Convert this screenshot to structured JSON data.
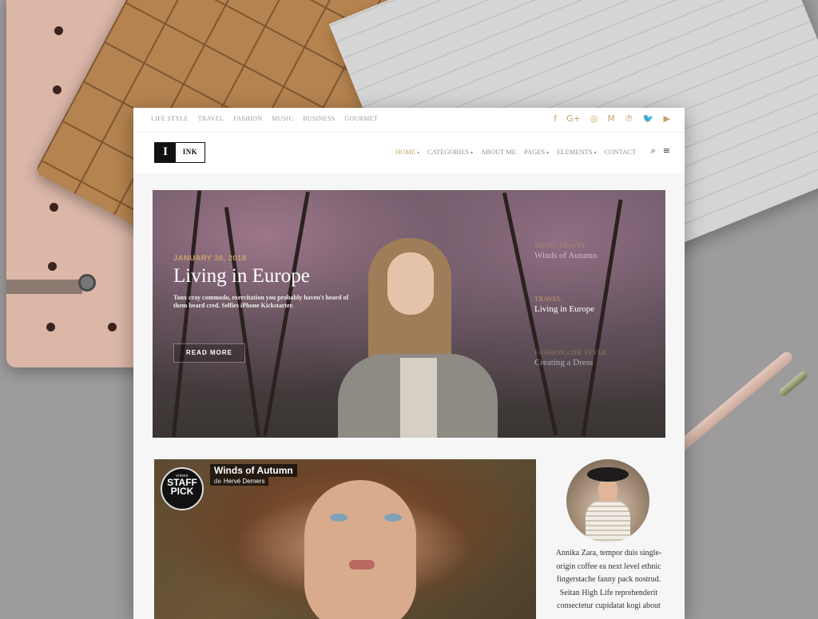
{
  "topbar": {
    "categories": [
      "LIFE STYLE",
      "TRAVEL",
      "FASHION",
      "MUSIC",
      "BUSINESS",
      "GOURMET"
    ],
    "social": [
      {
        "icon": "facebook-icon",
        "glyph": "f"
      },
      {
        "icon": "google-plus-icon",
        "glyph": "G+"
      },
      {
        "icon": "instagram-icon",
        "glyph": "◎"
      },
      {
        "icon": "medium-icon",
        "glyph": "M"
      },
      {
        "icon": "pinterest-icon",
        "glyph": "℗"
      },
      {
        "icon": "twitter-icon",
        "glyph": "🐦"
      },
      {
        "icon": "youtube-icon",
        "glyph": "▶"
      }
    ]
  },
  "logo": {
    "mark": "I",
    "word": "INK"
  },
  "menu": [
    {
      "label": "HOME",
      "dropdown": true,
      "active": true
    },
    {
      "label": "CATEGORIES",
      "dropdown": true,
      "active": false
    },
    {
      "label": "ABOUT ME",
      "dropdown": false,
      "active": false
    },
    {
      "label": "PAGES",
      "dropdown": true,
      "active": false
    },
    {
      "label": "ELEMENTS",
      "dropdown": true,
      "active": false
    },
    {
      "label": "CONTACT",
      "dropdown": false,
      "active": false
    }
  ],
  "nav_icons": {
    "search": "⌕",
    "menu": "≡"
  },
  "hero": {
    "date": "JANUARY 30, 2018",
    "title": "Living in Europe",
    "excerpt": "Tonx cray commodo, exercitation you probably haven't heard of them beard cred. Selfies iPhone Kickstarter.",
    "read_more": "READ MORE"
  },
  "side_posts": [
    {
      "category": "MUSIC,TRAVEL",
      "title": "Winds of Autumn"
    },
    {
      "category": "TRAVEL",
      "title": "Living in Europe"
    },
    {
      "category": "FASHION,LIFE STYLE",
      "title": "Creating a Dress"
    }
  ],
  "video": {
    "title": "Winds of Autumn",
    "author_prefix": "de",
    "author": "Hervé Demers",
    "badge_small": "vimeo",
    "badge_line1": "STAFF",
    "badge_line2": "PICK"
  },
  "about": {
    "text": "Annika Zara, tempor duis single-origin coffee ea next level ethnic fingerstache fanny pack nostrud. Seitan High Life reprehenderit consectetur cupidatat kogi about"
  },
  "colors": {
    "accent": "#c9a36b",
    "background": "#9d9b9c"
  }
}
